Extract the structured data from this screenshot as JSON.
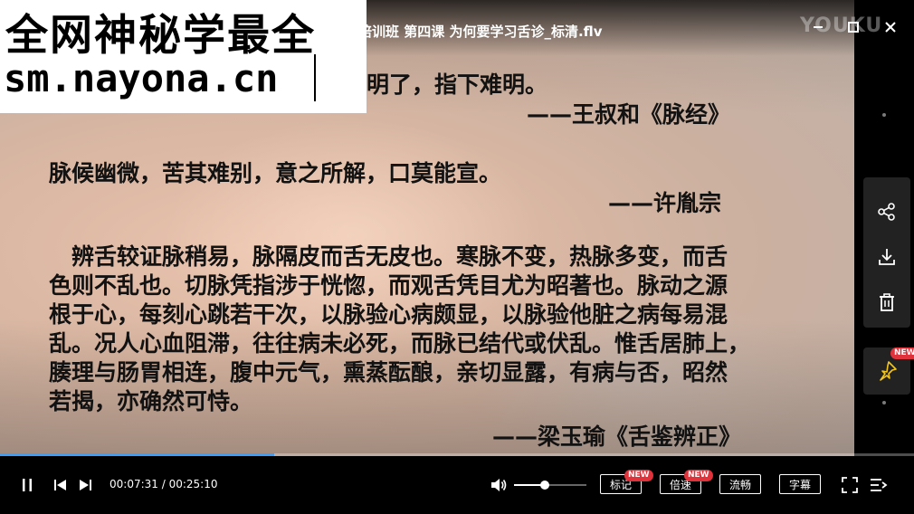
{
  "video": {
    "title": "培训班 第四课 为何要学习舌诊_标清.flv",
    "watermark_brand": "YOUKU",
    "lines": {
      "l1": "明了，指下难明。",
      "l2": "——王叔和《脉经》",
      "l3": "脉候幽微，苦其难别，意之所解，口莫能宣。",
      "l4": "——许胤宗",
      "para": [
        "　辨舌较证脉稍易，脉隔皮而舌无皮也。寒脉不变，热脉多变，而舌",
        "色则不乱也。切脉凭指涉于恍惚，而观舌凭目尤为昭著也。脉动之源",
        "根于心，每刻心跳若干次，以脉验心病颇显，以脉验他脏之病每易混",
        "乱。况人心血阻滞，往往病未必死，而脉已结代或伏乱。惟舌居肺上，",
        "腠理与肠胃相连，腹中元气，熏蒸酝酿，亲切显露，有病与否，昭然",
        "若揭，亦确然可恃。"
      ],
      "l5": "——梁玉瑜《舌鉴辨正》"
    }
  },
  "overlay": {
    "line1": "全网神秘学最全",
    "line2": "sm.nayona.cn"
  },
  "window": {
    "min_icon": "minimize-icon",
    "max_icon": "maximize-icon",
    "close_icon": "close-icon"
  },
  "side": {
    "share_icon": "share-icon",
    "download_icon": "download-icon",
    "delete_icon": "trash-icon",
    "pin_icon": "pin-icon",
    "pin_badge": "NEW"
  },
  "player": {
    "progress_fraction": 0.3,
    "current_time": "00:07:31",
    "total_time": "00:25:10",
    "volume_fraction": 0.42,
    "buttons": {
      "mark": "标记",
      "mark_badge": "NEW",
      "speed": "倍速",
      "speed_badge": "NEW",
      "quality": "流畅",
      "subtitle": "字幕"
    }
  },
  "colors": {
    "progress": "#3aa0ff",
    "badge": "#e0323a"
  }
}
